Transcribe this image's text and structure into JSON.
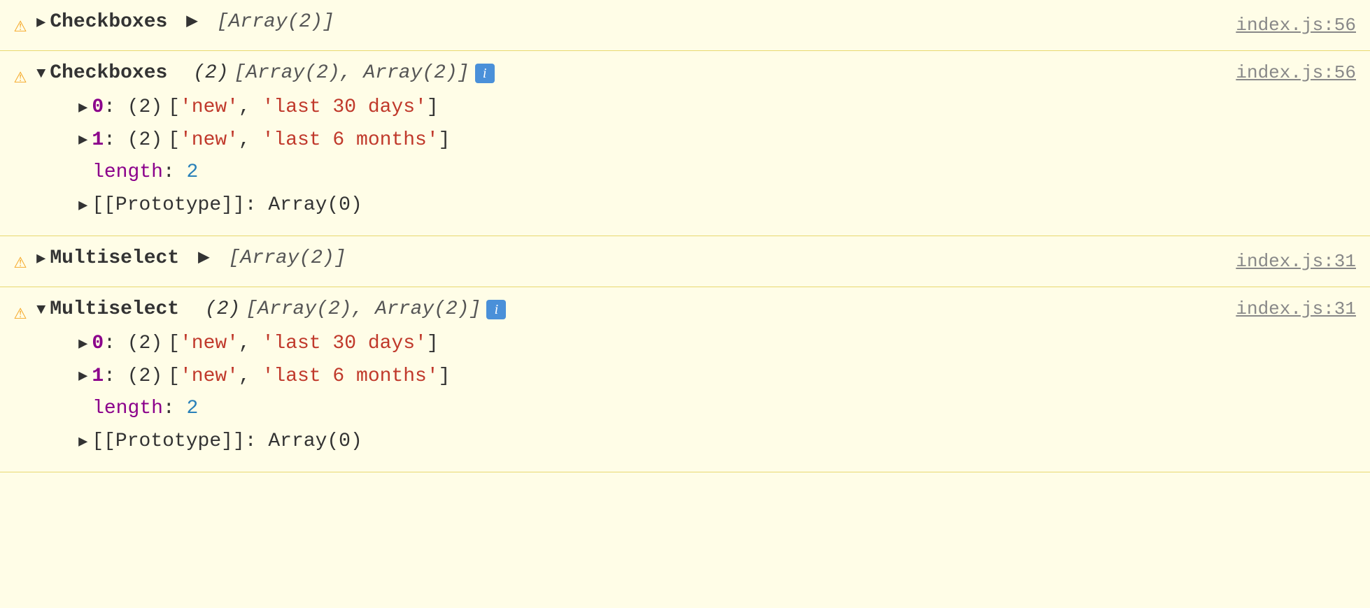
{
  "console": {
    "background": "#fffde7",
    "entries": [
      {
        "id": "entry-1",
        "type": "collapsed",
        "icon": "⚠",
        "component": "Checkboxes",
        "arrow": "▶",
        "array_display": "[Array(2)]",
        "file_link": "index.js:56"
      },
      {
        "id": "entry-2",
        "type": "expanded",
        "icon": "⚠",
        "component": "Checkboxes",
        "arrow_header": "▼",
        "count": "(2)",
        "array_labels": "[Array(2), Array(2)]",
        "has_info_badge": true,
        "info_badge_label": "i",
        "items": [
          {
            "index": "0",
            "count": "(2)",
            "values": [
              "'new'",
              "'last 30 days'"
            ]
          },
          {
            "index": "1",
            "count": "(2)",
            "values": [
              "'new'",
              "'last 6 months'"
            ]
          }
        ],
        "length_key": "length",
        "length_value": "2",
        "prototype_text": "[[Prototype]]: Array(0)",
        "file_link": "index.js:56"
      },
      {
        "id": "entry-3",
        "type": "collapsed",
        "icon": "⚠",
        "component": "Multiselect",
        "arrow": "▶",
        "array_display": "[Array(2)]",
        "file_link": "index.js:31"
      },
      {
        "id": "entry-4",
        "type": "expanded",
        "icon": "⚠",
        "component": "Multiselect",
        "arrow_header": "▼",
        "count": "(2)",
        "array_labels": "[Array(2), Array(2)]",
        "has_info_badge": true,
        "info_badge_label": "i",
        "items": [
          {
            "index": "0",
            "count": "(2)",
            "values": [
              "'new'",
              "'last 30 days'"
            ]
          },
          {
            "index": "1",
            "count": "(2)",
            "values": [
              "'new'",
              "'last 6 months'"
            ]
          }
        ],
        "length_key": "length",
        "length_value": "2",
        "prototype_text": "[[Prototype]]: Array(0)",
        "file_link": "index.js:31"
      }
    ]
  }
}
